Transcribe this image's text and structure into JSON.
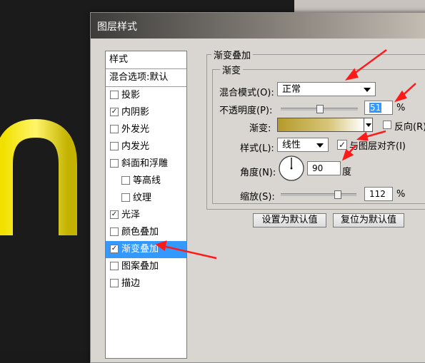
{
  "dialog": {
    "title": "图层样式"
  },
  "styles_panel": {
    "header": "样式",
    "blend_defaults": "混合选项:默认",
    "items": [
      {
        "label": "投影",
        "checked": false,
        "sub": false
      },
      {
        "label": "内阴影",
        "checked": true,
        "sub": false
      },
      {
        "label": "外发光",
        "checked": false,
        "sub": false
      },
      {
        "label": "内发光",
        "checked": false,
        "sub": false
      },
      {
        "label": "斜面和浮雕",
        "checked": false,
        "sub": false
      },
      {
        "label": "等高线",
        "checked": false,
        "sub": true
      },
      {
        "label": "纹理",
        "checked": false,
        "sub": true
      },
      {
        "label": "光泽",
        "checked": true,
        "sub": false
      },
      {
        "label": "颜色叠加",
        "checked": false,
        "sub": false
      },
      {
        "label": "渐变叠加",
        "checked": true,
        "sub": false,
        "selected": true
      },
      {
        "label": "图案叠加",
        "checked": false,
        "sub": false
      },
      {
        "label": "描边",
        "checked": false,
        "sub": false
      }
    ]
  },
  "gradient_overlay": {
    "section_title": "渐变叠加",
    "group_title": "渐变",
    "blend_mode_label": "混合模式(O):",
    "blend_mode_value": "正常",
    "opacity_label": "不透明度(P):",
    "opacity_value": "51",
    "opacity_fraction": 0.51,
    "percent_sign": "%",
    "gradient_label": "渐变:",
    "reverse_label": "反向(R)",
    "reverse_checked": false,
    "style_label": "样式(L):",
    "style_value": "线性",
    "align_label": "与图层对齐(I)",
    "align_checked": true,
    "angle_label": "角度(N):",
    "angle_value": "90",
    "angle_unit": "度",
    "scale_label": "缩放(S):",
    "scale_value": "112",
    "scale_fraction": 0.75,
    "make_default": "设置为默认值",
    "reset_default": "复位为默认值"
  },
  "colors": {
    "selection": "#3399ff",
    "annotation_arrow": "#ff1a1a",
    "gradient_from": "#b59a2a",
    "gradient_to": "#ffffff"
  }
}
